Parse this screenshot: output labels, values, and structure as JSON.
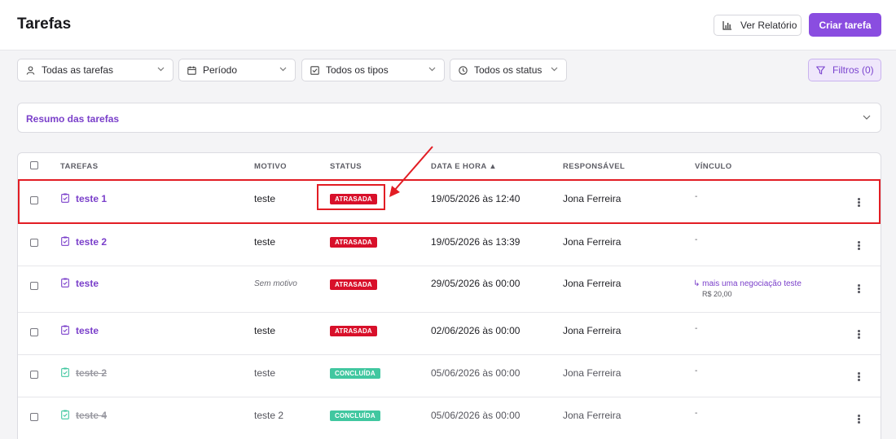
{
  "header": {
    "title": "Tarefas",
    "report_label": "Ver Relatório",
    "create_label": "Criar tarefa"
  },
  "filters": {
    "tasks": "Todas as tarefas",
    "period": "Período",
    "types": "Todos os tipos",
    "status": "Todos os status",
    "filters_button": "Filtros (0)"
  },
  "summary": {
    "title": "Resumo das tarefas"
  },
  "table": {
    "columns": {
      "tarefas": "TAREFAS",
      "motivo": "MOTIVO",
      "status": "STATUS",
      "data": "DATA E HORA ▲",
      "responsavel": "RESPONSÁVEL",
      "vinculo": "VÍNCULO"
    },
    "rows": [
      {
        "task": "teste 1",
        "motivo": "teste",
        "status": "ATRASADA",
        "date": "19/05/2026 às 12:40",
        "owner": "Jona Ferreira",
        "link": "-",
        "done": false
      },
      {
        "task": "teste 2",
        "motivo": "teste",
        "status": "ATRASADA",
        "date": "19/05/2026 às 13:39",
        "owner": "Jona Ferreira",
        "link": "-",
        "done": false
      },
      {
        "task": "teste",
        "motivo": "Sem motivo",
        "status": "ATRASADA",
        "date": "29/05/2026 às 00:00",
        "owner": "Jona Ferreira",
        "link": "↳ mais uma negociação teste",
        "link_sub": "R$ 20,00",
        "done": false
      },
      {
        "task": "teste",
        "motivo": "teste",
        "status": "ATRASADA",
        "date": "02/06/2026 às 00:00",
        "owner": "Jona Ferreira",
        "link": "-",
        "done": false
      },
      {
        "task": "teste 2",
        "motivo": "teste",
        "status": "CONCLUÍDA",
        "date": "05/06/2026 às 00:00",
        "owner": "Jona Ferreira",
        "link": "-",
        "done": true
      },
      {
        "task": "teste 4",
        "motivo": "teste 2",
        "status": "CONCLUÍDA",
        "date": "05/06/2026 às 00:00",
        "owner": "Jona Ferreira",
        "link": "-",
        "done": true
      }
    ]
  },
  "colors": {
    "accent": "#8a4de0",
    "late": "#d8102a",
    "done": "#41c7a0",
    "highlight": "#e21d24"
  },
  "icons": [
    "chart-bar-icon",
    "user-icon",
    "calendar-icon",
    "checkbox-icon",
    "clock-icon",
    "chevron-down-icon",
    "filter-icon",
    "task-icon",
    "more-icon"
  ]
}
